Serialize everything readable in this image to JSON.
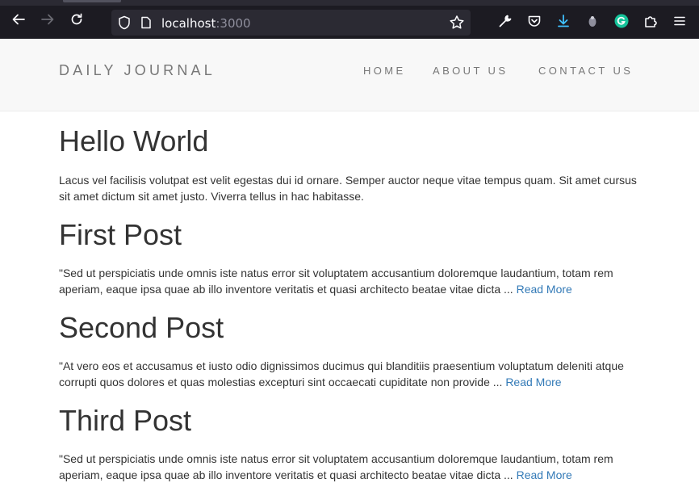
{
  "browser": {
    "url_host": "localhost",
    "url_port": ":3000"
  },
  "site": {
    "brand": "DAILY JOURNAL",
    "nav": [
      {
        "label": "HOME"
      },
      {
        "label": "ABOUT US"
      },
      {
        "label": "CONTACT US"
      }
    ]
  },
  "intro": {
    "title": "Hello World",
    "body": "Lacus vel facilisis volutpat est velit egestas dui id ornare. Semper auctor neque vitae tempus quam. Sit amet cursus sit amet dictum sit amet justo. Viverra tellus in hac habitasse."
  },
  "posts": [
    {
      "title": "First Post",
      "excerpt": "\"Sed ut perspiciatis unde omnis iste natus error sit voluptatem accusantium doloremque laudantium, totam rem aperiam, eaque ipsa quae ab illo inventore veritatis et quasi architecto beatae vitae dicta ...",
      "link_label": "Read More"
    },
    {
      "title": "Second Post",
      "excerpt": "\"At vero eos et accusamus et iusto odio dignissimos ducimus qui blanditiis praesentium voluptatum deleniti atque corrupti quos dolores et quas molestias excepturi sint occaecati cupiditate non provide ...",
      "link_label": "Read More"
    },
    {
      "title": "Third Post",
      "excerpt": "\"Sed ut perspiciatis unde omnis iste natus error sit voluptatem accusantium doloremque laudantium, totam rem aperiam, eaque ipsa quae ab illo inventore veritatis et quasi architecto beatae vitae dicta ...",
      "link_label": "Read More"
    }
  ],
  "colors": {
    "link": "#337ab7",
    "header_bg": "#f8f8f8",
    "browser_bg": "#1c1b22"
  },
  "icons": {
    "back": "back-arrow-icon",
    "forward": "forward-arrow-icon",
    "reload": "reload-icon",
    "shield": "shield-icon",
    "page": "page-icon",
    "bookmark": "star-icon",
    "tools": "wrench-icon",
    "pocket": "pocket-icon",
    "download": "download-icon",
    "extension": "extension-icon",
    "grammarly": "grammarly-icon",
    "puzzle": "puzzle-icon",
    "menu": "hamburger-menu-icon"
  }
}
